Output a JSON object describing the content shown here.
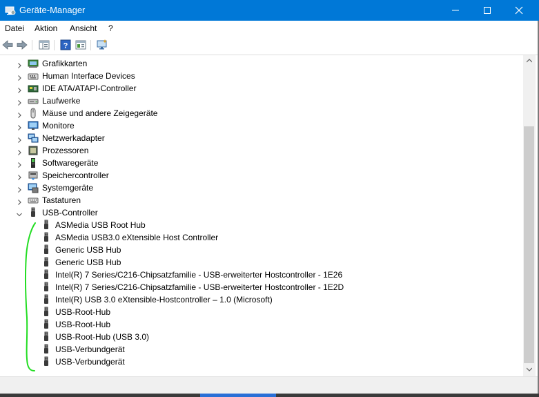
{
  "window": {
    "title": "Geräte-Manager"
  },
  "menu": [
    {
      "label": "Datei"
    },
    {
      "label": "Aktion"
    },
    {
      "label": "Ansicht"
    },
    {
      "label": "?"
    }
  ],
  "toolbar": {
    "buttons": [
      "back-arrow-icon",
      "forward-arrow-icon",
      "properties-pane-icon",
      "help-icon",
      "show-view-icon",
      "monitor-scan-icon"
    ]
  },
  "tree": {
    "categories": [
      {
        "label": "Grafikkarten",
        "icon": "display-adapter-icon",
        "expanded": false
      },
      {
        "label": "Human Interface Devices",
        "icon": "hid-icon",
        "expanded": false
      },
      {
        "label": "IDE ATA/ATAPI-Controller",
        "icon": "ide-controller-icon",
        "expanded": false
      },
      {
        "label": "Laufwerke",
        "icon": "disk-drive-icon",
        "expanded": false
      },
      {
        "label": "Mäuse und andere Zeigegeräte",
        "icon": "mouse-icon",
        "expanded": false
      },
      {
        "label": "Monitore",
        "icon": "monitor-icon",
        "expanded": false
      },
      {
        "label": "Netzwerkadapter",
        "icon": "network-adapter-icon",
        "expanded": false
      },
      {
        "label": "Prozessoren",
        "icon": "processor-icon",
        "expanded": false
      },
      {
        "label": "Softwaregeräte",
        "icon": "software-device-icon",
        "expanded": false
      },
      {
        "label": "Speichercontroller",
        "icon": "storage-controller-icon",
        "expanded": false
      },
      {
        "label": "Systemgeräte",
        "icon": "system-device-icon",
        "expanded": false
      },
      {
        "label": "Tastaturen",
        "icon": "keyboard-icon",
        "expanded": false
      },
      {
        "label": "USB-Controller",
        "icon": "usb-icon",
        "expanded": true
      }
    ],
    "usb_children": [
      {
        "label": "ASMedia USB Root Hub"
      },
      {
        "label": "ASMedia USB3.0 eXtensible Host Controller"
      },
      {
        "label": "Generic USB Hub"
      },
      {
        "label": "Generic USB Hub"
      },
      {
        "label": "Intel(R) 7 Series/C216-Chipsatzfamilie - USB-erweiterter Hostcontroller - 1E26"
      },
      {
        "label": "Intel(R) 7 Series/C216-Chipsatzfamilie - USB-erweiterter Hostcontroller - 1E2D"
      },
      {
        "label": "Intel(R) USB 3.0 eXtensible-Hostcontroller – 1.0 (Microsoft)"
      },
      {
        "label": "USB-Root-Hub"
      },
      {
        "label": "USB-Root-Hub"
      },
      {
        "label": "USB-Root-Hub (USB 3.0)"
      },
      {
        "label": "USB-Verbundgerät"
      },
      {
        "label": "USB-Verbundgerät"
      }
    ]
  },
  "colors": {
    "titlebar": "#0078d7",
    "annotation": "#22dd22"
  }
}
